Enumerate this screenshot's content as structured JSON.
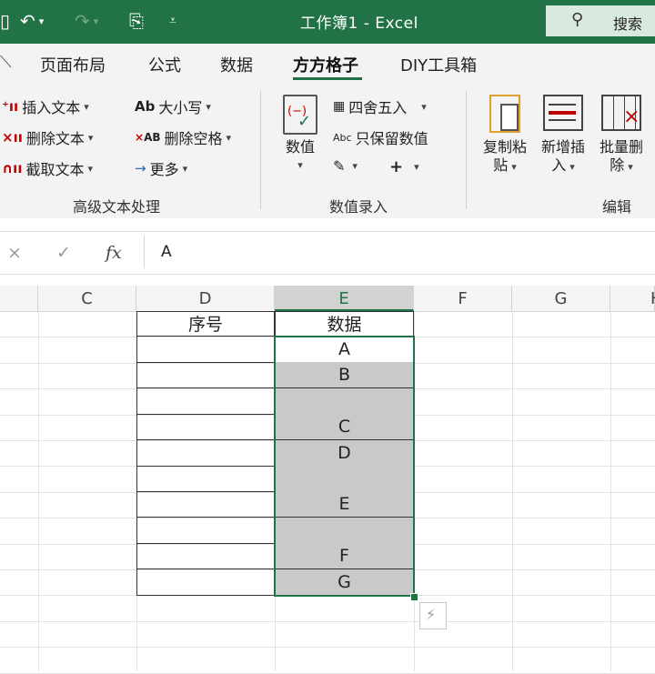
{
  "window": {
    "title": "工作簿1  -  Excel",
    "search_label": "搜索"
  },
  "tabs": [
    {
      "label": "页面布局"
    },
    {
      "label": "公式"
    },
    {
      "label": "数据"
    },
    {
      "label": "方方格子"
    },
    {
      "label": "DIY工具箱"
    }
  ],
  "ribbon": {
    "text_group": {
      "label": "高级文本处理",
      "insert_text": "插入文本",
      "delete_text": "删除文本",
      "cut_text": "截取文本",
      "case": "大小写",
      "case_icon_text": "Ab",
      "remove_spaces": "删除空格",
      "remove_spaces_icon_text": "AB",
      "more": "更多"
    },
    "entry_group": {
      "label": "数值录入",
      "numeric": "数值",
      "round": "四舍五入",
      "keep_numbers": "只保留数值",
      "keep_numbers_icon_text": "Abc",
      "plus": "+"
    },
    "edit_group": {
      "label": "编辑",
      "copy_paste_1": "复制粘",
      "copy_paste_2": "贴",
      "insert_new_1": "新增插",
      "insert_new_2": "入",
      "batch_delete_1": "批量删",
      "batch_delete_2": "除"
    }
  },
  "formula_bar": {
    "cancel": "×",
    "enter": "✓",
    "fx": "fx",
    "value": "A"
  },
  "columns": [
    {
      "label": "C"
    },
    {
      "label": "D"
    },
    {
      "label": "E"
    },
    {
      "label": "F"
    },
    {
      "label": "G"
    },
    {
      "label": "H"
    }
  ],
  "table": {
    "header_d": "序号",
    "header_e": "数据",
    "rows": [
      "A",
      "B",
      "",
      "C",
      "D",
      "",
      "E",
      "",
      "F",
      "G"
    ]
  }
}
